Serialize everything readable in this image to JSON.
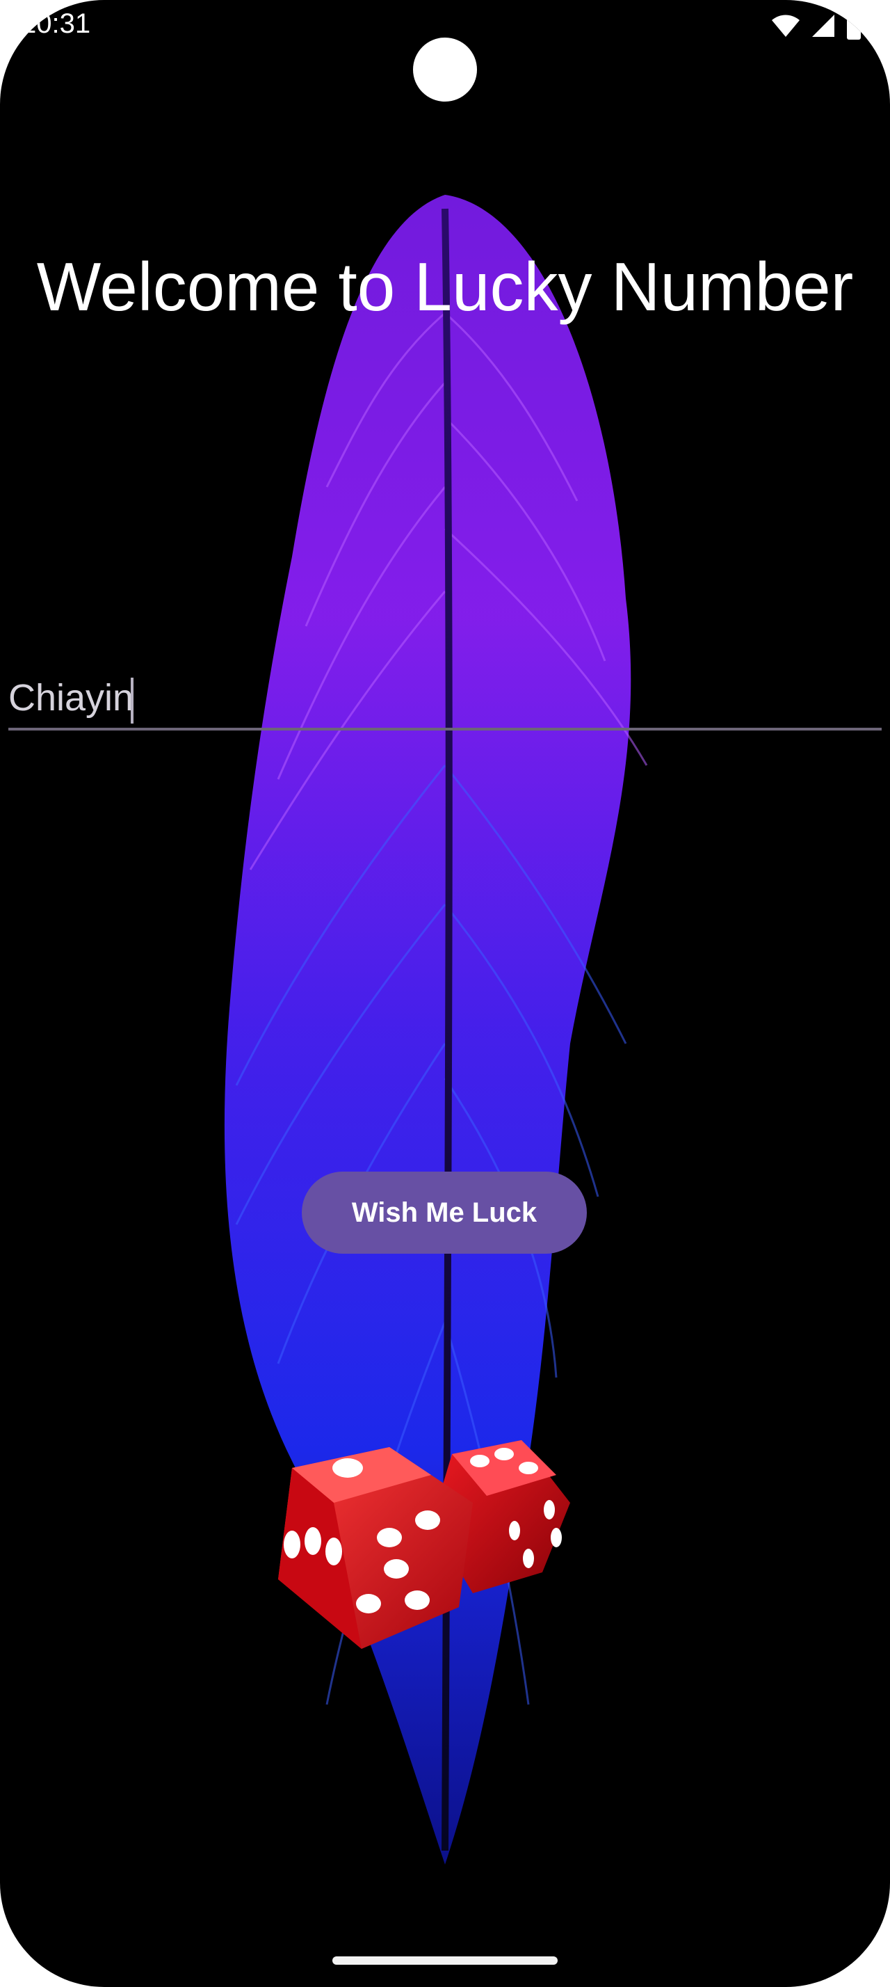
{
  "status_bar": {
    "time": "10:31",
    "icons": [
      "wifi-icon",
      "signal-icon",
      "battery-icon"
    ]
  },
  "main": {
    "title": "Welcome to Lucky Number",
    "name_input": {
      "value": "Chiayin",
      "placeholder": ""
    },
    "wish_button_label": "Wish Me Luck"
  },
  "colors": {
    "background": "#000000",
    "button": "#6750a4",
    "button_text": "#ffffff",
    "title_text": "#ffffff",
    "feather_top": "#8a1cff",
    "feather_bottom": "#1f2cff",
    "dice": "#d3101a"
  },
  "images": {
    "background": "feather-image",
    "illustration": "dice-image"
  }
}
